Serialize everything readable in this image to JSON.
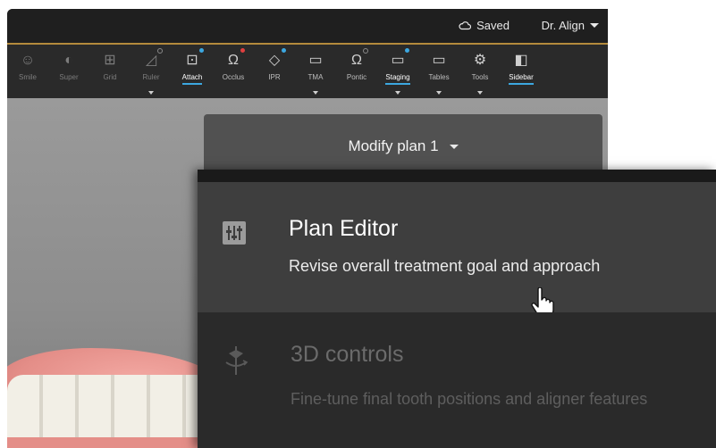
{
  "header": {
    "saved_label": "Saved",
    "user_label": "Dr. Align"
  },
  "toolbar": {
    "items": [
      {
        "label": "Smile",
        "icon": "smile-icon"
      },
      {
        "label": "Super",
        "icon": "superimpose-icon"
      },
      {
        "label": "Grid",
        "icon": "grid-icon"
      },
      {
        "label": "Ruler",
        "icon": "ruler-icon"
      },
      {
        "label": "Attach",
        "icon": "attachment-icon"
      },
      {
        "label": "Occlus",
        "icon": "occlusion-icon"
      },
      {
        "label": "IPR",
        "icon": "ipr-icon"
      },
      {
        "label": "TMA",
        "icon": "folder-icon"
      },
      {
        "label": "Pontic",
        "icon": "pontic-icon"
      },
      {
        "label": "Staging",
        "icon": "staging-icon"
      },
      {
        "label": "Tables",
        "icon": "folder-icon"
      },
      {
        "label": "Tools",
        "icon": "gear-icon"
      },
      {
        "label": "Sidebar",
        "icon": "sidebar-icon"
      }
    ]
  },
  "plan": {
    "selector_label": "Modify plan 1"
  },
  "menu": {
    "items": [
      {
        "title": "Plan Editor",
        "description": "Revise overall treatment goal and approach",
        "icon": "sliders-icon"
      },
      {
        "title": "3D controls",
        "description": "Fine-tune final tooth positions and aligner features",
        "icon": "3d-controls-icon"
      }
    ]
  },
  "colors": {
    "accent_blue": "#3ca7e0",
    "accent_red": "#e04040",
    "title_underline": "#b48a3c"
  }
}
